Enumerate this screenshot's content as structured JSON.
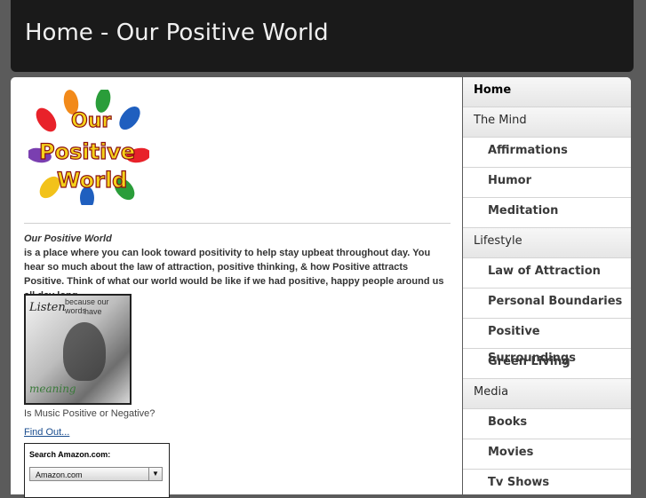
{
  "header": {
    "title": "Home - Our Positive World"
  },
  "logo": {
    "words": [
      "Our",
      "Positive",
      "World"
    ]
  },
  "intro": {
    "title": "Our Positive World",
    "body": "is a place where you can look toward positivity to help stay upbeat throughout day. You hear so much about the law of attraction, positive thinking, & how Positive attracts Positive. Think of what our world would be like if we had positive, happy people around us all day long."
  },
  "photo": {
    "text_listen": "Listen",
    "text_because": "because our words",
    "text_have": "have",
    "text_meaning": "meaning"
  },
  "music": {
    "caption": "Is Music Positive or Negative?",
    "link": "Find Out..."
  },
  "amazon": {
    "label": "Search Amazon.com:",
    "selected": "Amazon.com"
  },
  "nav": {
    "items": [
      {
        "label": "Home",
        "level": "top"
      },
      {
        "label": "The Mind",
        "level": "top"
      },
      {
        "label": "Affirmations",
        "level": "sub"
      },
      {
        "label": "Humor",
        "level": "sub"
      },
      {
        "label": "Meditation",
        "level": "sub"
      },
      {
        "label": "Lifestyle",
        "level": "top"
      },
      {
        "label": "Law of Attraction",
        "level": "sub"
      },
      {
        "label": "Personal Boundaries",
        "level": "sub"
      },
      {
        "label": "Positive Surroundings",
        "level": "sub"
      },
      {
        "label": "Green Living",
        "level": "sub"
      },
      {
        "label": "Media",
        "level": "top"
      },
      {
        "label": "Books",
        "level": "sub"
      },
      {
        "label": "Movies",
        "level": "sub"
      },
      {
        "label": "Tv Shows",
        "level": "sub"
      }
    ]
  }
}
